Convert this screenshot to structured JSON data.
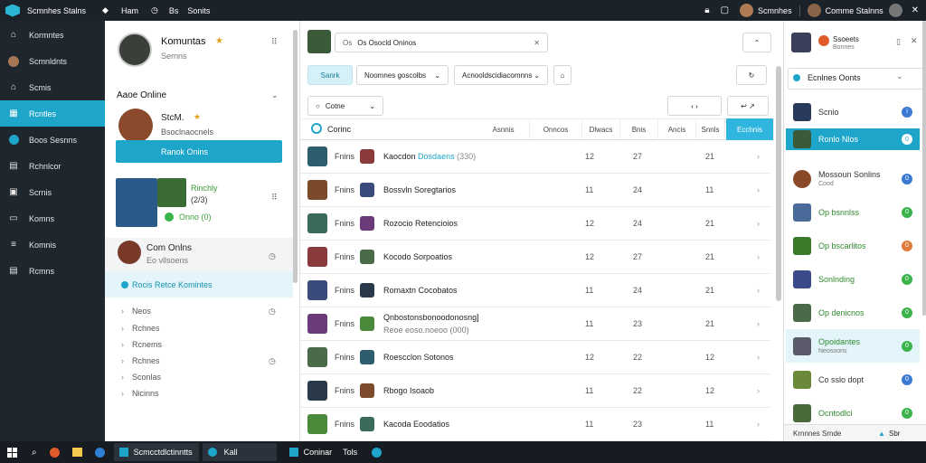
{
  "top": {
    "app_title": "Scmnhes Stalns",
    "menu1": "Ham",
    "menu2": "Bs",
    "menu3": "Sonits",
    "user_right": "Scmnhes",
    "user_right2": "Comme Stalnns"
  },
  "nav": {
    "items": [
      {
        "label": "Kormntes",
        "icon": "home-icon"
      },
      {
        "label": "Scmnldnts",
        "icon": "avatar-icon"
      },
      {
        "label": "Scmis",
        "icon": "house-icon"
      },
      {
        "label": "Rcntles",
        "icon": "calendar-icon"
      },
      {
        "label": "Boos Sesnns",
        "icon": "circle-icon"
      },
      {
        "label": "Rchnlcor",
        "icon": "doc-icon"
      },
      {
        "label": "Scrnis",
        "icon": "bag-icon"
      },
      {
        "label": "Komns",
        "icon": "monitor-icon"
      },
      {
        "label": "Komnis",
        "icon": "list-icon"
      },
      {
        "label": "Rcmns",
        "icon": "doc2-icon"
      }
    ]
  },
  "p1": {
    "profile_name": "Komuntas",
    "profile_sub": "Sernns",
    "section1": "Aaoe Online",
    "friend1_name": "StcM.",
    "friend1_sub": "Bsoclnaocnels",
    "friend1_btn": "Ranok Onins",
    "group_label": "Rinchly",
    "group_sub": "(2/3)",
    "group_status": "Onno (0)",
    "section2_title": "Com Onlns",
    "section2_sub": "Eo vllsoens",
    "highlight": "Rocis Retce Komintes",
    "list": [
      "Neos",
      "Rchnes",
      "Rcnems",
      "Rchnes",
      "Sconlas",
      "Nicinns"
    ]
  },
  "p2": {
    "search_value": "Os Osocld Oninos",
    "btn_search": "Sanrk",
    "dropdown1": "Noomnes goscolbs",
    "dropdown2": "Acnooldscidiacomnns",
    "filter_label": "Cotne",
    "header_first": "Corinc",
    "headers": [
      "Asnnis",
      "Onncos",
      "Dlwacs",
      "Bnis",
      "Ancis",
      "Snnls"
    ],
    "selected_header": "Ecchnis",
    "rows": [
      {
        "status": "Fnins",
        "name": "Kaocdon",
        "name_hl": "Dosdaens",
        "extra": "(330)",
        "c1": "12",
        "c2": "27",
        "c3": "21"
      },
      {
        "status": "Fnins",
        "name": "Bossvln Soregtarios",
        "name_hl": "",
        "extra": "",
        "c1": "11",
        "c2": "24",
        "c3": "11"
      },
      {
        "status": "Fnins",
        "name": "Rozocio Retencioios",
        "name_hl": "",
        "extra": "",
        "c1": "12",
        "c2": "24",
        "c3": "21"
      },
      {
        "status": "Fnins",
        "name": "Kocodo Sorpoatios",
        "name_hl": "",
        "extra": "",
        "c1": "12",
        "c2": "27",
        "c3": "21"
      },
      {
        "status": "Fnins",
        "name": "Romaxtn Cocobatos",
        "name_hl": "",
        "extra": "",
        "c1": "11",
        "c2": "24",
        "c3": "21"
      },
      {
        "status": "Fnins",
        "name": "Qnbostonsbonoodonosng]",
        "name_hl": "",
        "extra": "",
        "sub": "Reoe eoso.noeoo (000)",
        "c1": "11",
        "c2": "23",
        "c3": "21"
      },
      {
        "status": "Fnins",
        "name": "Roescclon Sotonos",
        "name_hl": "",
        "extra": "",
        "c1": "12",
        "c2": "22",
        "c3": "12"
      },
      {
        "status": "Fnins",
        "name": "Rbogo Isoaob",
        "name_hl": "",
        "extra": "",
        "c1": "11",
        "c2": "22",
        "c3": "12"
      },
      {
        "status": "Fnins",
        "name": "Kacoda Eoodatios",
        "name_hl": "",
        "extra": "",
        "c1": "11",
        "c2": "23",
        "c3": "11"
      }
    ]
  },
  "p3": {
    "top_title": "Ssoeets",
    "top_sub": "Bonnes",
    "section": "Ecnlnes Oonts",
    "items": [
      {
        "name": "Scnio",
        "sub": "",
        "badge": "i"
      },
      {
        "name": "Ronlo Nlos",
        "sub": "",
        "badge": "0"
      },
      {
        "name": "Mossoun Sonlins",
        "sub": "Cood",
        "badge": "0"
      },
      {
        "name": "Op bsnnlss",
        "sub": "",
        "badge": "0"
      },
      {
        "name": "Op bscarlitos",
        "sub": "",
        "badge": "0"
      },
      {
        "name": "Sonlnding",
        "sub": "",
        "badge": "0"
      },
      {
        "name": "Op denicnos",
        "sub": "",
        "badge": "0"
      },
      {
        "name": "Opoidantes",
        "sub": "Neosoons",
        "badge": "0"
      },
      {
        "name": "Co sslo dopt",
        "sub": "",
        "badge": "0"
      },
      {
        "name": "Ocntodlci",
        "sub": "",
        "badge": "0"
      }
    ],
    "footer": "Krnnnes Srnde",
    "footer_right": "Sbr"
  },
  "taskbar": {
    "item1": "Scmcctdlctinntts",
    "item2": "Kall",
    "item3": "Coninar",
    "item4": "Tols"
  }
}
